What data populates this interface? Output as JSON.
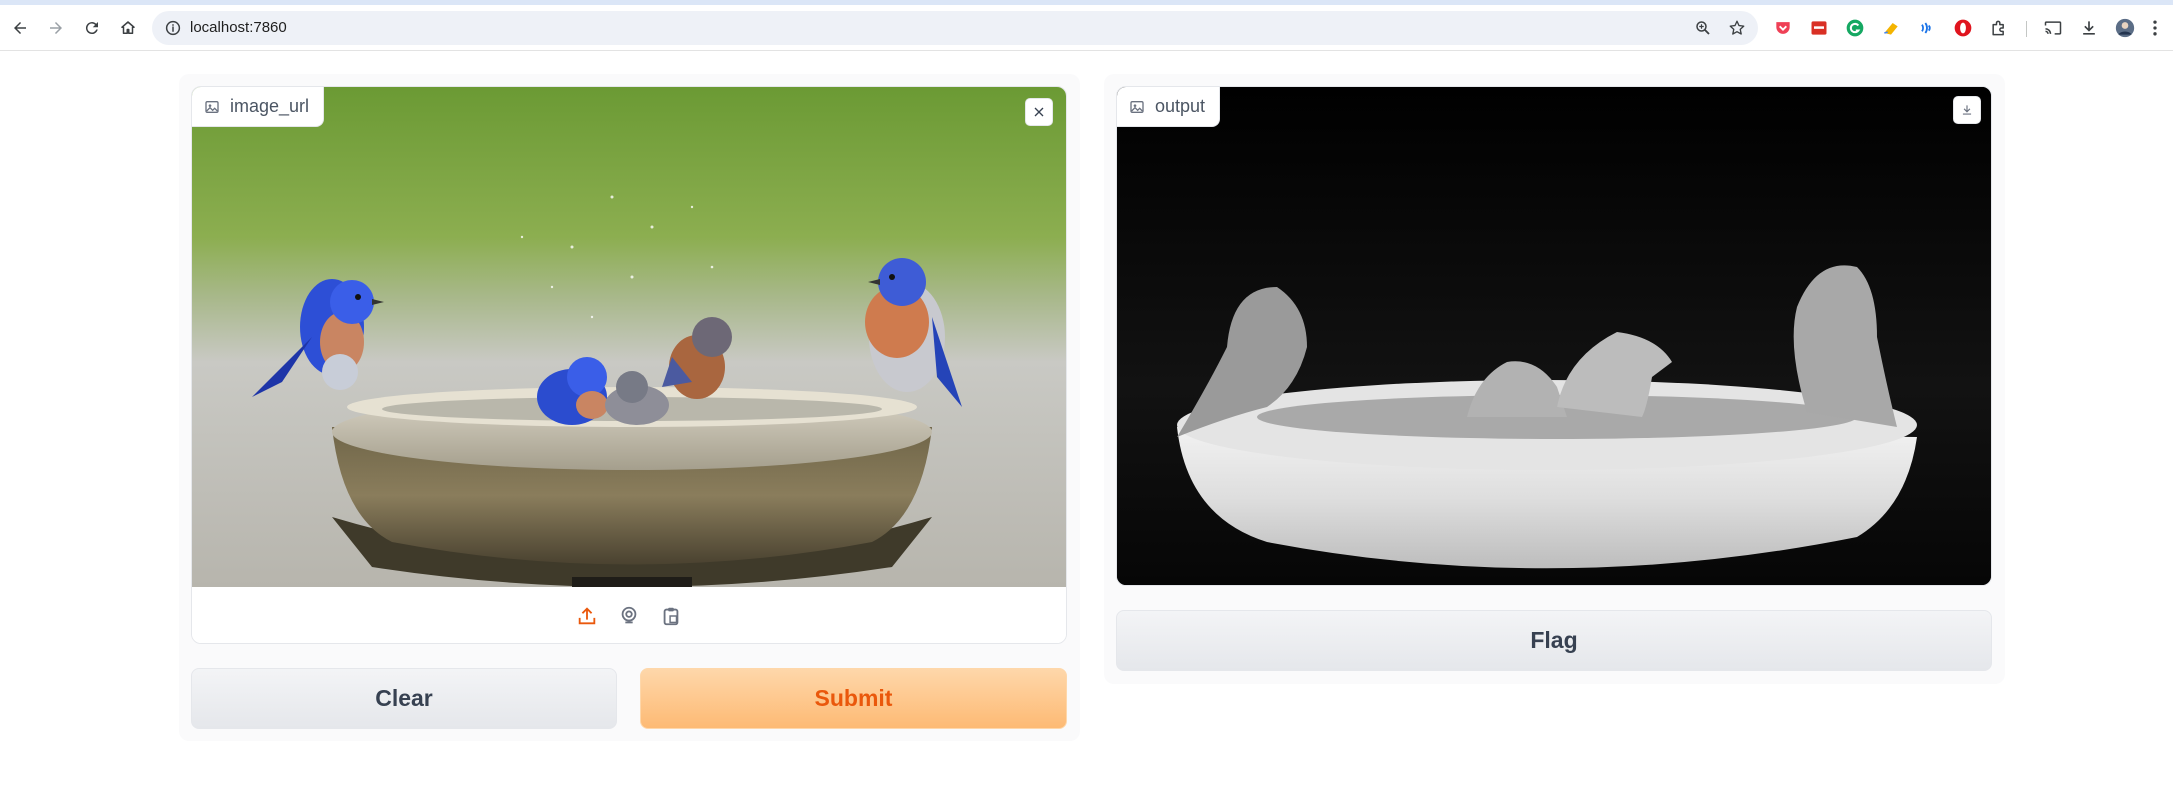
{
  "browser": {
    "url": "localhost:7860",
    "icons": [
      "back-icon",
      "forward-icon",
      "reload-icon",
      "home-icon",
      "site-info-icon",
      "zoom-icon",
      "bookmark-star-icon",
      "pocket-icon",
      "extension-icon",
      "grammarly-icon",
      "extension-icon",
      "extension-icon",
      "opera-icon",
      "puzzle-icon",
      "cast-icon",
      "download-icon",
      "avatar",
      "menu-icon"
    ]
  },
  "input_image": {
    "label": "image_url",
    "source_icons": [
      "upload-icon",
      "webcam-icon",
      "clipboard-icon"
    ]
  },
  "output_image": {
    "label": "output"
  },
  "buttons": {
    "clear": "Clear",
    "submit": "Submit",
    "flag": "Flag"
  },
  "colors": {
    "accent": "#ea580c",
    "primary_bg": "#fdba74",
    "secondary_bg": "#e5e7eb"
  }
}
